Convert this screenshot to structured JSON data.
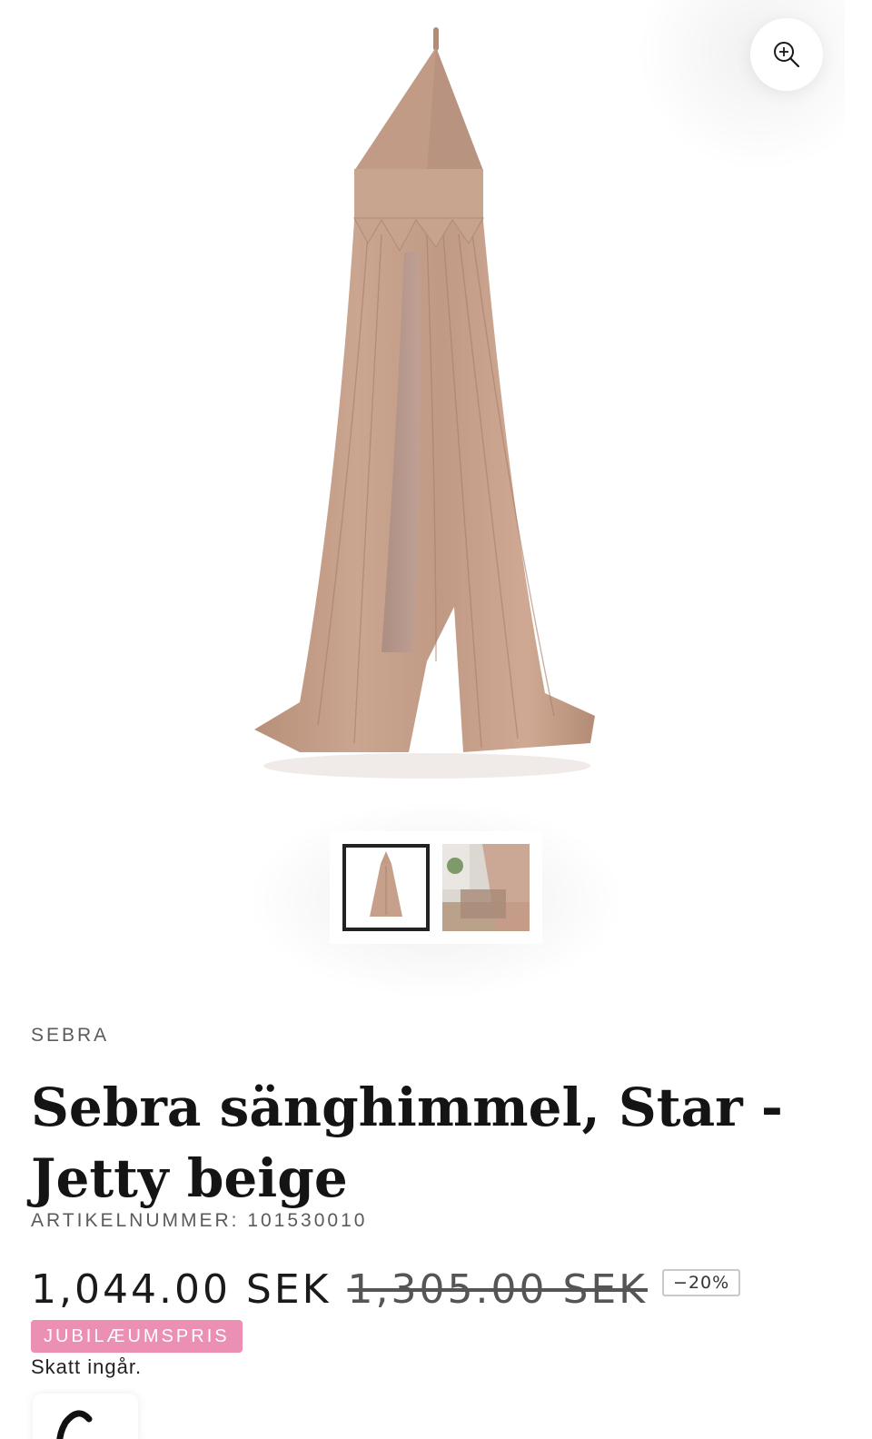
{
  "gallery": {
    "zoom_icon": "zoom-in-icon",
    "hero_alt": "Sebra sänghimmel, Star - Jetty beige",
    "thumbnails": [
      {
        "icon": "canopy-thumbnail",
        "active": true
      },
      {
        "icon": "room-thumbnail",
        "active": false
      }
    ]
  },
  "product": {
    "brand": "SEBRA",
    "title": "Sebra sänghimmel, Star - Jetty beige",
    "sku_label": "ARTIKELNUMMER:",
    "sku_value": "101530010",
    "price_now": "1,044.00 SEK",
    "price_was": "1,305.00 SEK",
    "discount": "−20%",
    "badge": "JUBILÆUMSPRIS",
    "tax_note": "Skatt ingår."
  },
  "colors": {
    "badge_bg": "#ec8fb4",
    "fabric": "#c49c85"
  }
}
